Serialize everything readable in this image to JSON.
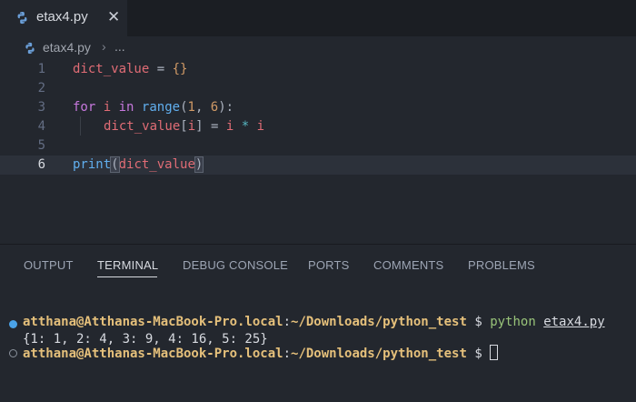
{
  "tab": {
    "title": "etax4.py",
    "close_glyph": "✕",
    "icon": "python-icon"
  },
  "breadcrumb": {
    "file": "etax4.py",
    "separator": "›",
    "more": "..."
  },
  "editor": {
    "line_numbers": [
      "1",
      "2",
      "3",
      "4",
      "5",
      "6"
    ],
    "lines": {
      "l1": {
        "var": "dict_value",
        "eq": " = ",
        "braces": "{}"
      },
      "l3": {
        "kw_for": "for",
        "i": "i",
        "kw_in": "in",
        "fn_range": "range",
        "open": "(",
        "n1": "1",
        "comma": ", ",
        "n2": "6",
        "close": "):"
      },
      "l4": {
        "var": "dict_value",
        "lb": "[",
        "i": "i",
        "rb": "]",
        "eq": " = ",
        "i2": "i",
        "mul": " * ",
        "i3": "i"
      },
      "l6": {
        "fn_print": "print",
        "open": "(",
        "var": "dict_value",
        "close": ")"
      }
    }
  },
  "panel": {
    "tabs": [
      "OUTPUT",
      "TERMINAL",
      "DEBUG CONSOLE",
      "PORTS",
      "COMMENTS",
      "PROBLEMS"
    ],
    "active_tab": "TERMINAL"
  },
  "terminal": {
    "line1": {
      "user_host": "atthana@Atthanas-MacBook-Pro.local",
      "colon": ":",
      "path": "~/Downloads/python_test",
      "prompt": " $ ",
      "cmd": "python",
      "arg": "etax4.py"
    },
    "output": "{1: 1, 2: 4, 3: 9, 4: 16, 5: 25}",
    "line3": {
      "user_host": "atthana@Atthanas-MacBook-Pro.local",
      "colon": ":",
      "path": "~/Downloads/python_test",
      "prompt": " $ "
    }
  },
  "colors": {
    "background": "#23272e",
    "keyword": "#c678dd",
    "variable": "#e06c75",
    "function": "#61afef",
    "number": "#d19a66",
    "prompt": "#e5c07b",
    "command": "#98c379"
  }
}
